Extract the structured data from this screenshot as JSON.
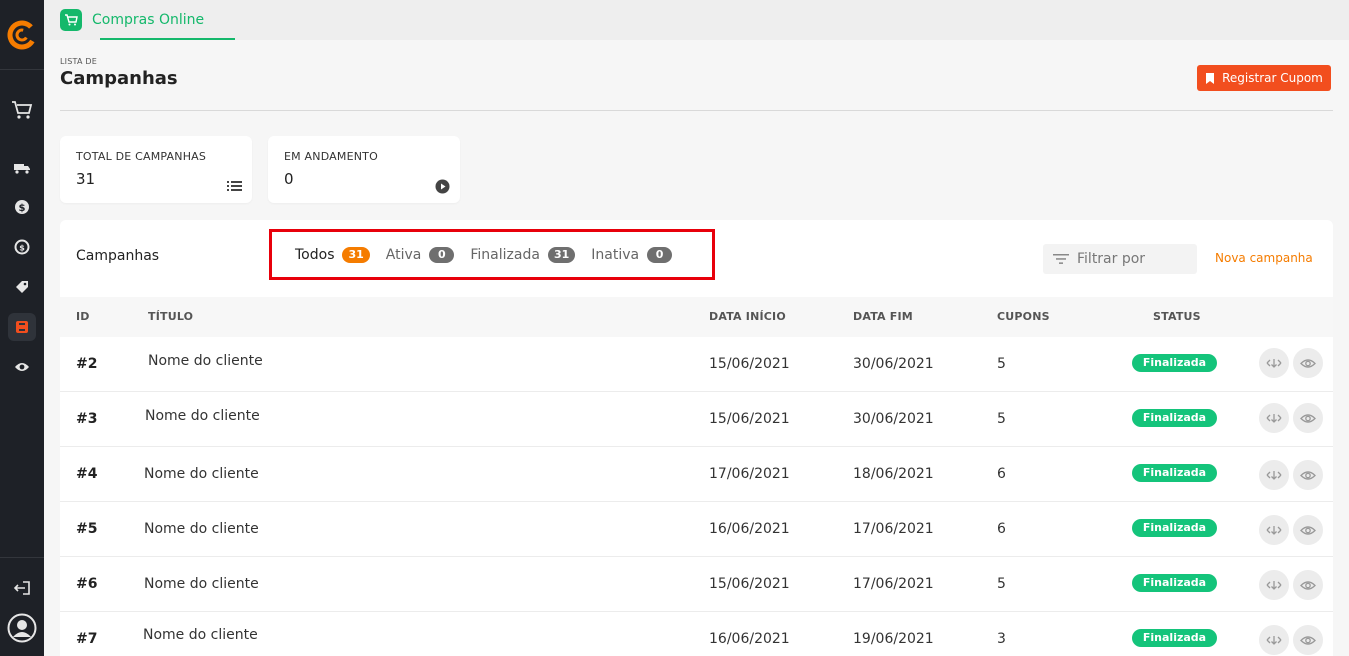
{
  "colors": {
    "accent": "#14b86b",
    "orange": "#f57c00",
    "register": "#f24e1e",
    "status_green": "#14c47b",
    "highlight": "#e8000b"
  },
  "sidebar": {
    "icons": [
      "logo-icon",
      "cart-icon",
      "truck-icon",
      "money-icon",
      "refresh-money-icon",
      "tag-icon",
      "campaign-icon",
      "eye-icon",
      "logout-icon",
      "user-icon"
    ]
  },
  "topbar": {
    "app_tab_label": "Compras Online"
  },
  "header": {
    "overline": "LISTA DE",
    "title": "Campanhas",
    "register_button": "Registrar Cupom"
  },
  "stats": [
    {
      "label": "TOTAL DE CAMPANHAS",
      "value": "31"
    },
    {
      "label": "EM ANDAMENTO",
      "value": "0"
    }
  ],
  "panel": {
    "title": "Campanhas",
    "tabs": [
      {
        "label": "Todos",
        "count": "31"
      },
      {
        "label": "Ativa",
        "count": "0"
      },
      {
        "label": "Finalizada",
        "count": "31"
      },
      {
        "label": "Inativa",
        "count": "0"
      }
    ],
    "filter_placeholder": "Filtrar por",
    "new_campaign": "Nova campanha"
  },
  "table": {
    "columns": {
      "id": "ID",
      "title": "TÍTULO",
      "start": "DATA INÍCIO",
      "end": "DATA FIM",
      "coupons": "CUPONS",
      "status": "STATUS"
    },
    "rows": [
      {
        "id": "#2",
        "title": "Nome do cliente",
        "start": "15/06/2021",
        "end": "30/06/2021",
        "coupons": "5",
        "status": "Finalizada"
      },
      {
        "id": "#3",
        "title": "Nome do cliente",
        "start": "15/06/2021",
        "end": "30/06/2021",
        "coupons": "5",
        "status": "Finalizada"
      },
      {
        "id": "#4",
        "title": "Nome do cliente",
        "start": "17/06/2021",
        "end": "18/06/2021",
        "coupons": "6",
        "status": "Finalizada"
      },
      {
        "id": "#5",
        "title": "Nome do cliente",
        "start": "16/06/2021",
        "end": "17/06/2021",
        "coupons": "6",
        "status": "Finalizada"
      },
      {
        "id": "#6",
        "title": "Nome do cliente",
        "start": "15/06/2021",
        "end": "17/06/2021",
        "coupons": "5",
        "status": "Finalizada"
      },
      {
        "id": "#7",
        "title": "Nome do cliente",
        "start": "16/06/2021",
        "end": "19/06/2021",
        "coupons": "3",
        "status": "Finalizada"
      }
    ]
  }
}
